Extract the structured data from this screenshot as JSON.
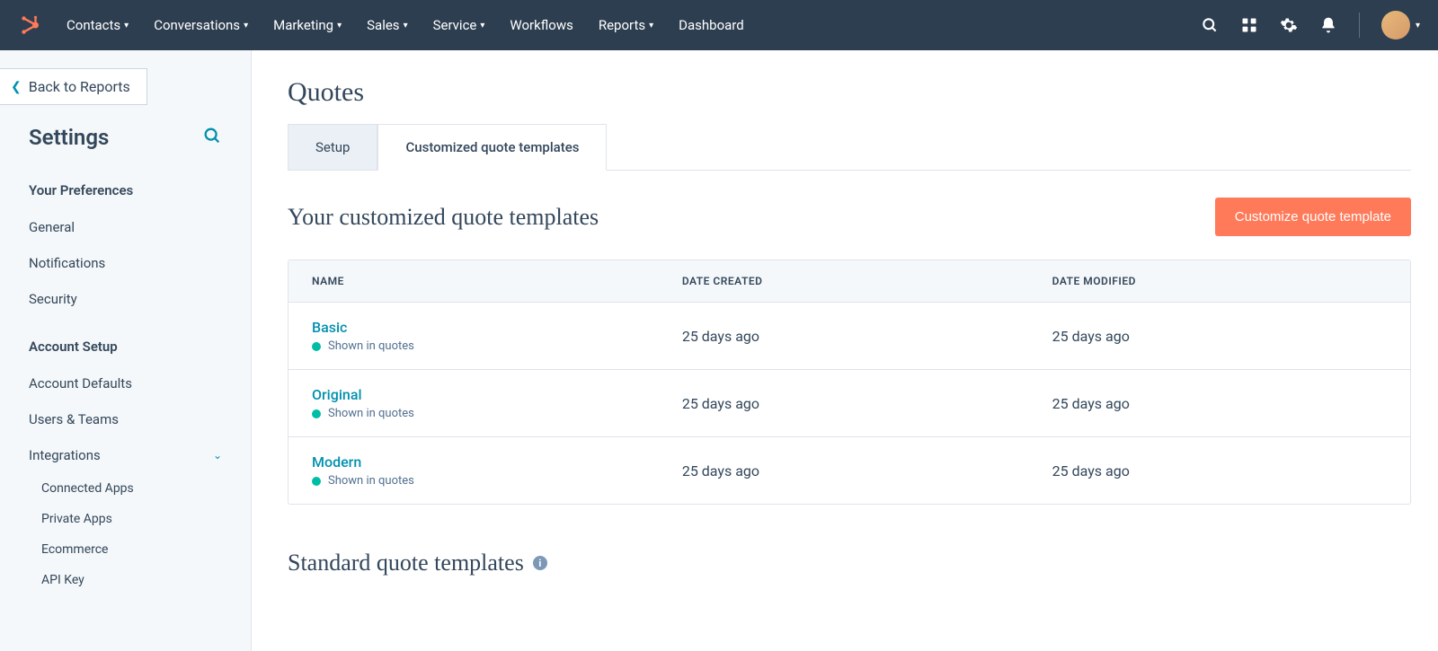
{
  "topnav": {
    "items": [
      {
        "label": "Contacts",
        "has_menu": true
      },
      {
        "label": "Conversations",
        "has_menu": true
      },
      {
        "label": "Marketing",
        "has_menu": true
      },
      {
        "label": "Sales",
        "has_menu": true
      },
      {
        "label": "Service",
        "has_menu": true
      },
      {
        "label": "Workflows",
        "has_menu": false
      },
      {
        "label": "Reports",
        "has_menu": true
      },
      {
        "label": "Dashboard",
        "has_menu": false
      }
    ]
  },
  "sidebar": {
    "back_label": "Back to Reports",
    "title": "Settings",
    "sections": [
      {
        "title": "Your Preferences",
        "items": [
          {
            "label": "General"
          },
          {
            "label": "Notifications"
          },
          {
            "label": "Security"
          }
        ]
      },
      {
        "title": "Account Setup",
        "items": [
          {
            "label": "Account Defaults"
          },
          {
            "label": "Users & Teams"
          },
          {
            "label": "Integrations",
            "expanded": true,
            "children": [
              {
                "label": "Connected Apps"
              },
              {
                "label": "Private Apps"
              },
              {
                "label": "Ecommerce"
              },
              {
                "label": "API Key"
              }
            ]
          }
        ]
      }
    ]
  },
  "main": {
    "page_title": "Quotes",
    "tabs": [
      {
        "label": "Setup",
        "active": false
      },
      {
        "label": "Customized quote templates",
        "active": true
      }
    ],
    "section1": {
      "title": "Your customized quote templates",
      "button": "Customize quote template",
      "columns": {
        "name": "NAME",
        "created": "DATE CREATED",
        "modified": "DATE MODIFIED"
      },
      "rows": [
        {
          "name": "Basic",
          "status": "Shown in quotes",
          "created": "25 days ago",
          "modified": "25 days ago"
        },
        {
          "name": "Original",
          "status": "Shown in quotes",
          "created": "25 days ago",
          "modified": "25 days ago"
        },
        {
          "name": "Modern",
          "status": "Shown in quotes",
          "created": "25 days ago",
          "modified": "25 days ago"
        }
      ]
    },
    "section2": {
      "title": "Standard quote templates"
    }
  }
}
